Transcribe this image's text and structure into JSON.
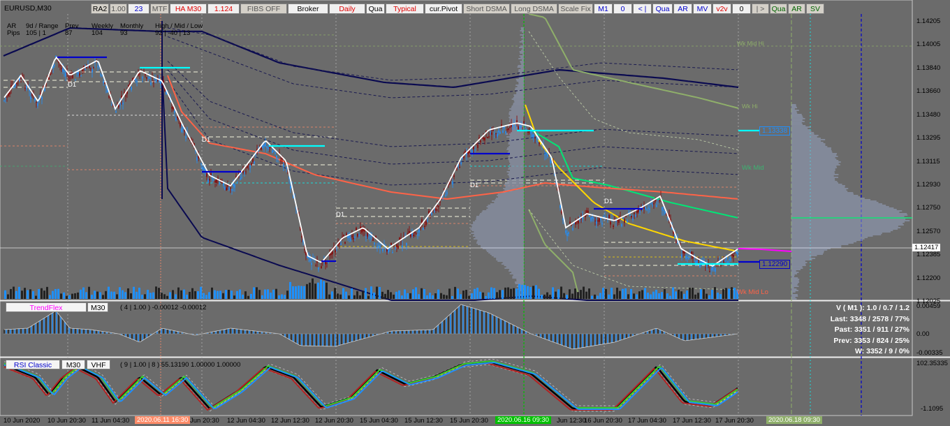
{
  "symbol": "EURUSD,M30",
  "toolbar": [
    {
      "label": "RA2",
      "color": "#000",
      "bg": "#d4d0c8"
    },
    {
      "label": "1.00",
      "color": "#555",
      "bg": "#d4d0c8"
    },
    {
      "label": "23",
      "color": "#0000cc",
      "bg": "#f0f0f0"
    },
    {
      "label": "MTF",
      "color": "#555",
      "bg": "#d4d0c8"
    },
    {
      "label": "HA M30",
      "color": "#e00000",
      "bg": "#f0f0f0"
    },
    {
      "label": "1.124",
      "color": "#e00000",
      "bg": "#f0f0f0"
    },
    {
      "label": "FIBS OFF",
      "color": "#555",
      "bg": "#d4d0c8"
    },
    {
      "label": "Broker",
      "color": "#000",
      "bg": "#f0f0f0"
    },
    {
      "label": "Daily",
      "color": "#e00000",
      "bg": "#f0f0f0"
    },
    {
      "label": "Qua",
      "color": "#000",
      "bg": "#f0f0f0"
    },
    {
      "label": "Typical",
      "color": "#e00000",
      "bg": "#f0f0f0"
    },
    {
      "label": "cur.Pivot",
      "color": "#000",
      "bg": "#f0f0f0"
    },
    {
      "label": "Short DSMA",
      "color": "#555",
      "bg": "#d4d0c8"
    },
    {
      "label": "Long DSMA",
      "color": "#555",
      "bg": "#d4d0c8"
    },
    {
      "label": "Scale Fix",
      "color": "#555",
      "bg": "#d4d0c8"
    },
    {
      "label": "M1",
      "color": "#0000cc",
      "bg": "#f0f0f0"
    },
    {
      "label": "0",
      "color": "#0000cc",
      "bg": "#f0f0f0"
    },
    {
      "label": "< |",
      "color": "#0000cc",
      "bg": "#f0f0f0"
    },
    {
      "label": "Qua",
      "color": "#0000cc",
      "bg": "#f0f0f0"
    },
    {
      "label": "AR",
      "color": "#0000cc",
      "bg": "#f0f0f0"
    },
    {
      "label": "MV",
      "color": "#0000cc",
      "bg": "#f0f0f0"
    },
    {
      "label": "v2v",
      "color": "#e00000",
      "bg": "#f0f0f0"
    },
    {
      "label": "0",
      "color": "#000",
      "bg": "#f0f0f0"
    },
    {
      "label": "| >",
      "color": "#555",
      "bg": "#d4d0c8"
    },
    {
      "label": "Qua",
      "color": "#006400",
      "bg": "#d4d0c8"
    },
    {
      "label": "AR",
      "color": "#006400",
      "bg": "#d4d0c8"
    },
    {
      "label": "SV",
      "color": "#006400",
      "bg": "#d4d0c8"
    }
  ],
  "range_table": {
    "row1": [
      "AR",
      "9d / Range",
      "Prev",
      "Weekly",
      "Monthly",
      "High / Mid / Low"
    ],
    "row2": [
      "Pips",
      "105 | 1",
      "87",
      "104",
      "93",
      "92 | -40 | 13"
    ]
  },
  "price_axis": [
    "1.14205",
    "1.14005",
    "1.13840",
    "1.13660",
    "1.13480",
    "1.13295",
    "1.13115",
    "1.12930",
    "1.12750",
    "1.12570",
    "1.12385",
    "1.12200",
    "1.12025"
  ],
  "current_price": "1.12417",
  "price_tags": {
    "upper": "1.13338",
    "lower": "1.12290"
  },
  "chart_labels": {
    "d1": "D1",
    "wk_mid": "Wk Mid",
    "wk_mid_lo": "Wk Mid Lo",
    "wk_hi": "Wk Mid Hi",
    "wk_x": "Wk Hi"
  },
  "trendflex": {
    "name": "TrendFlex",
    "tf": "M30",
    "params": "( 4 | 1.00 ) -0.00012 -0.00012",
    "axis": [
      "0.00459",
      "0.00",
      "-0.00335"
    ]
  },
  "rsi": {
    "name": "RSI Classic",
    "tf": "M30",
    "extra": "VHF",
    "params": "( 9 | 1.00 | 8 ) 55.13190 1.00000 1.00000",
    "axis": [
      "102.35335",
      "-1.1095"
    ]
  },
  "stats": [
    "V ( M1 ): 1.0 / 0.7 / 1.2",
    "Last: 3348 / 2578 / 77%",
    "Past: 3351 / 911 / 27%",
    "Prev: 3353 / 824 / 25%",
    "W: 3352 / 9 / 0%"
  ],
  "time_axis": [
    "10 Jun 2020",
    "10 Jun 20:30",
    "11 Jun 04:30",
    "2020.06.11 16:30",
    "Jun 20:30",
    "12 Jun 04:30",
    "12 Jun 12:30",
    "12 Jun 20:30",
    "15 Jun 04:30",
    "15 Jun 12:30",
    "15 Jun 20:30",
    "2020.06.16 09:30",
    "Jun 12:30",
    "16 Jun 20:30",
    "17 Jun 04:30",
    "17 Jun 12:30",
    "17 Jun 20:30",
    "2020.06.18 09:30"
  ],
  "colors": {
    "bg": "#6b6b6b",
    "bull": "#1e90ff",
    "bear": "#8b0000",
    "ha": "#ffffff",
    "navy": "#0a0a50",
    "orange": "#ff6347",
    "green": "#3cb371",
    "yellow": "#ffd700",
    "cyan": "#00ffff"
  }
}
